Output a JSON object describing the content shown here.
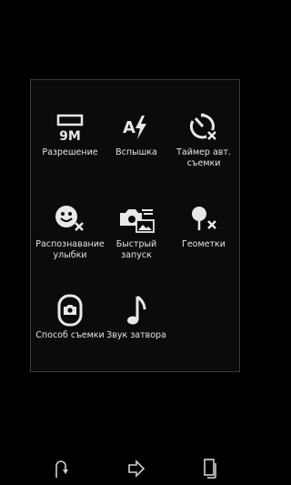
{
  "menu": {
    "items": [
      {
        "label": "Разрешение",
        "icon": "resolution-9m-icon",
        "badge": "9M"
      },
      {
        "label": "Вспышка",
        "icon": "flash-auto-icon"
      },
      {
        "label": "Таймер авт. съемки",
        "icon": "self-timer-off-icon"
      },
      {
        "label": "Распознавание улыбки",
        "icon": "smile-detection-off-icon"
      },
      {
        "label": "Быстрый запуск",
        "icon": "quick-launch-icon"
      },
      {
        "label": "Геометки",
        "icon": "geotag-off-icon"
      },
      {
        "label": "Способ съемки",
        "icon": "capture-method-icon"
      },
      {
        "label": "Звук затвора",
        "icon": "shutter-sound-icon"
      }
    ]
  },
  "navbar": {
    "buttons": [
      "back-icon",
      "forward-icon",
      "recent-apps-icon"
    ]
  },
  "colors": {
    "background": "#000000",
    "panel": "#0b0b0b",
    "icon": "#e8e8e8"
  }
}
